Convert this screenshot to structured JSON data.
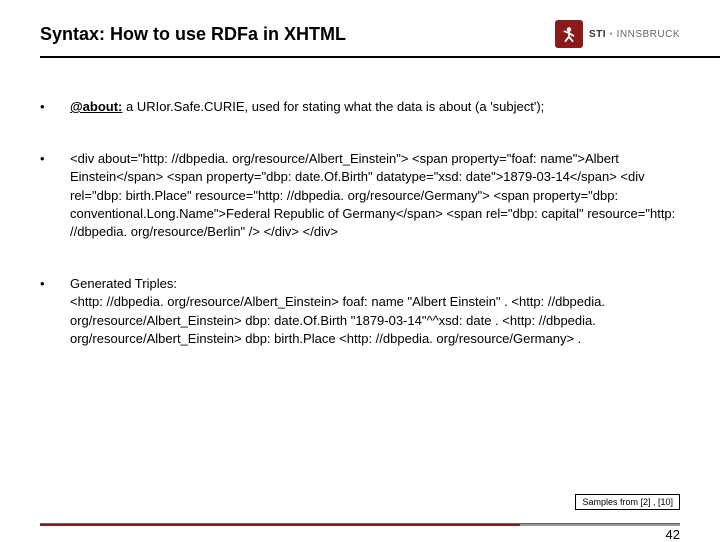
{
  "header": {
    "title": "Syntax: How to use RDFa in XHTML",
    "logo": {
      "name": "sti-logo",
      "org": "STI",
      "city": "INNSBRUCK"
    }
  },
  "bullets": [
    {
      "label": "@about:",
      "rest": " a URIor.Safe.CURIE, used for stating what the data is about (a 'subject');"
    },
    {
      "code": "<div about=\"http: //dbpedia. org/resource/Albert_Einstein\"> <span property=\"foaf: name\">Albert Einstein</span> <span property=\"dbp: date.Of.Birth\" datatype=\"xsd: date\">1879-03-14</span> <div rel=\"dbp: birth.Place\" resource=\"http: //dbpedia. org/resource/Germany\"> <span property=\"dbp: conventional.Long.Name\">Federal Republic of Germany</span> <span rel=\"dbp: capital\" resource=\"http: //dbpedia. org/resource/Berlin\" /> </div> </div>"
    },
    {
      "triples_heading": "Generated Triples:",
      "triples_body": "<http: //dbpedia. org/resource/Albert_Einstein> foaf: name \"Albert Einstein\" . <http: //dbpedia. org/resource/Albert_Einstein> dbp: date.Of.Birth \"1879-03-14\"^^xsd: date . <http: //dbpedia. org/resource/Albert_Einstein> dbp: birth.Place <http: //dbpedia. org/resource/Germany> ."
    }
  ],
  "footer": {
    "samples": "Samples from [2] , [10]",
    "page": "42"
  }
}
